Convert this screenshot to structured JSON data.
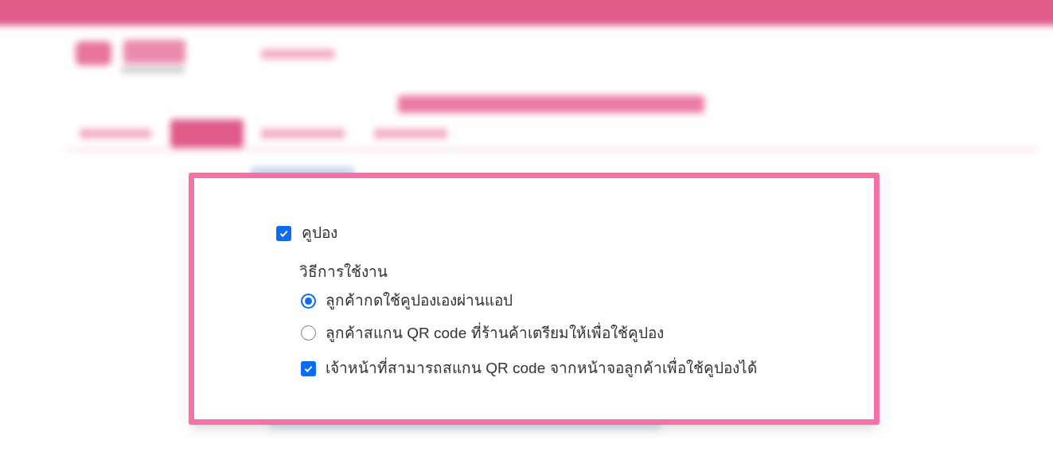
{
  "coupon": {
    "label": "คูปอง",
    "checked": true
  },
  "usage": {
    "title": "วิธีการใช้งาน",
    "options": [
      {
        "label": "ลูกค้ากดใช้คูปองเองผ่านแอป",
        "selected": true
      },
      {
        "label": "ลูกค้าสแกน QR code ที่ร้านค้าเตรียมให้เพื่อใช้คูปอง",
        "selected": false
      }
    ]
  },
  "staff_scan": {
    "label": "เจ้าหน้าที่สามารถสแกน QR code จากหน้าจอลูกค้าเพื่อใช้คูปองได้",
    "checked": true
  }
}
